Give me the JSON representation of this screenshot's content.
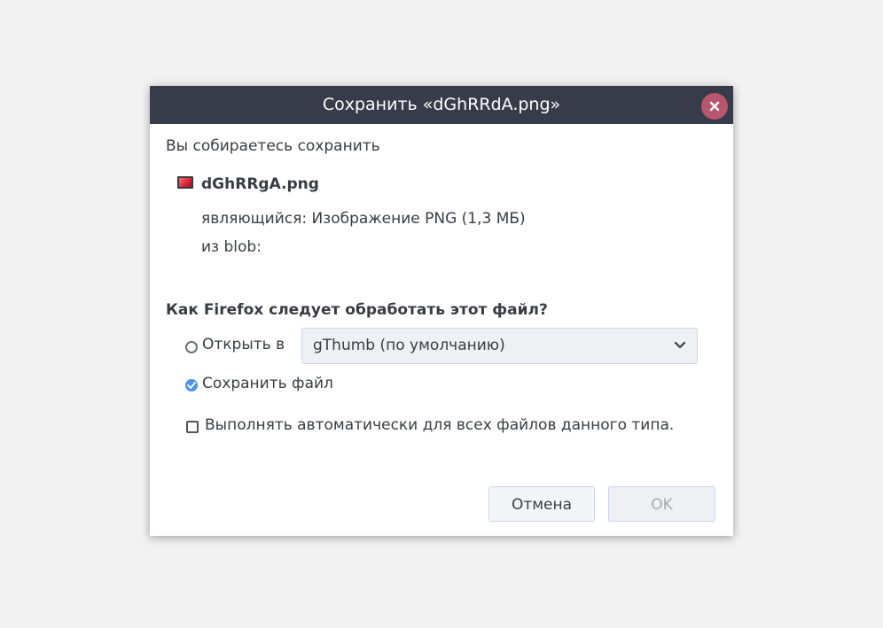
{
  "dialog": {
    "title": "Сохранить «dGhRRdA.png»",
    "intro": "Вы собираетесь сохранить",
    "file": {
      "icon": "png-image-icon",
      "name": "dGhRRgA.png",
      "type_line": "являющийся: Изображение PNG (1,3 МБ)",
      "from_line": "из blob:"
    },
    "question": "Как Firefox следует обработать этот файл?",
    "options": {
      "open_label": "Открыть в",
      "open_selected": false,
      "open_app": "gThumb (по умолчанию)",
      "save_label": "Сохранить файл",
      "save_selected": true
    },
    "auto_label": "Выполнять автоматически для всех файлов данного типа.",
    "auto_checked": false,
    "buttons": {
      "cancel": "Отмена",
      "ok": "OK",
      "ok_enabled": false
    }
  },
  "colors": {
    "titlebar": "#383c4a",
    "close_button": "#b7566f",
    "accent": "#5294e2"
  }
}
